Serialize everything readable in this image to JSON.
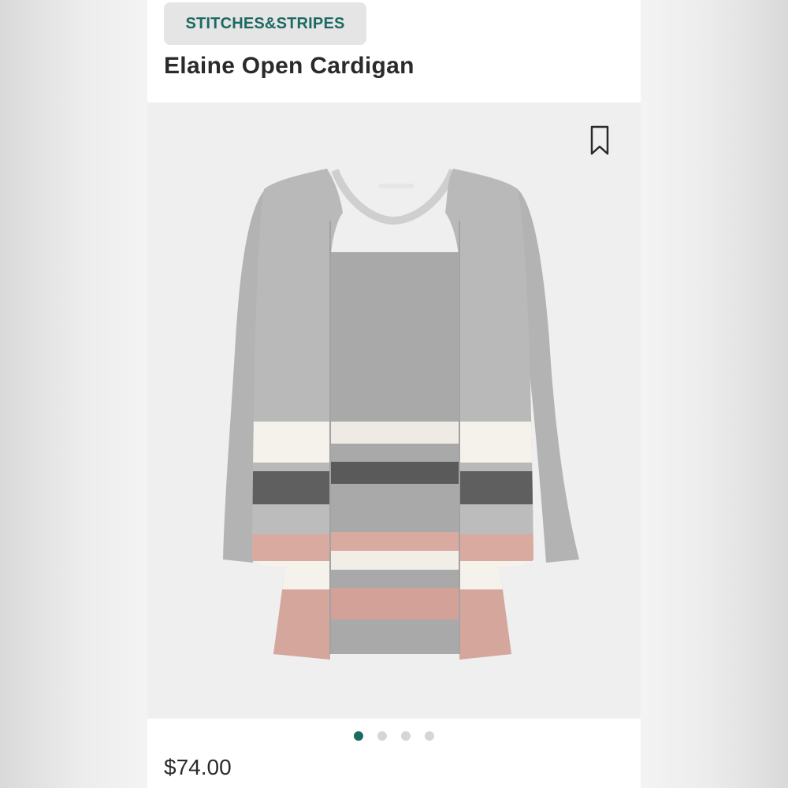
{
  "brand": {
    "label": "STITCHES&STRIPES"
  },
  "product": {
    "title": "Elaine Open Cardigan",
    "price": "$74.00"
  },
  "gallery": {
    "image_count": 4,
    "active_index": 0,
    "bookmark_icon": "bookmark-icon"
  },
  "colors": {
    "brand_accent": "#1d6a63",
    "sweater_gray": "#b9b9b9",
    "stripe_white": "#f5f2ec",
    "stripe_charcoal": "#5f5f5f",
    "stripe_pink": "#d9aaa0"
  }
}
